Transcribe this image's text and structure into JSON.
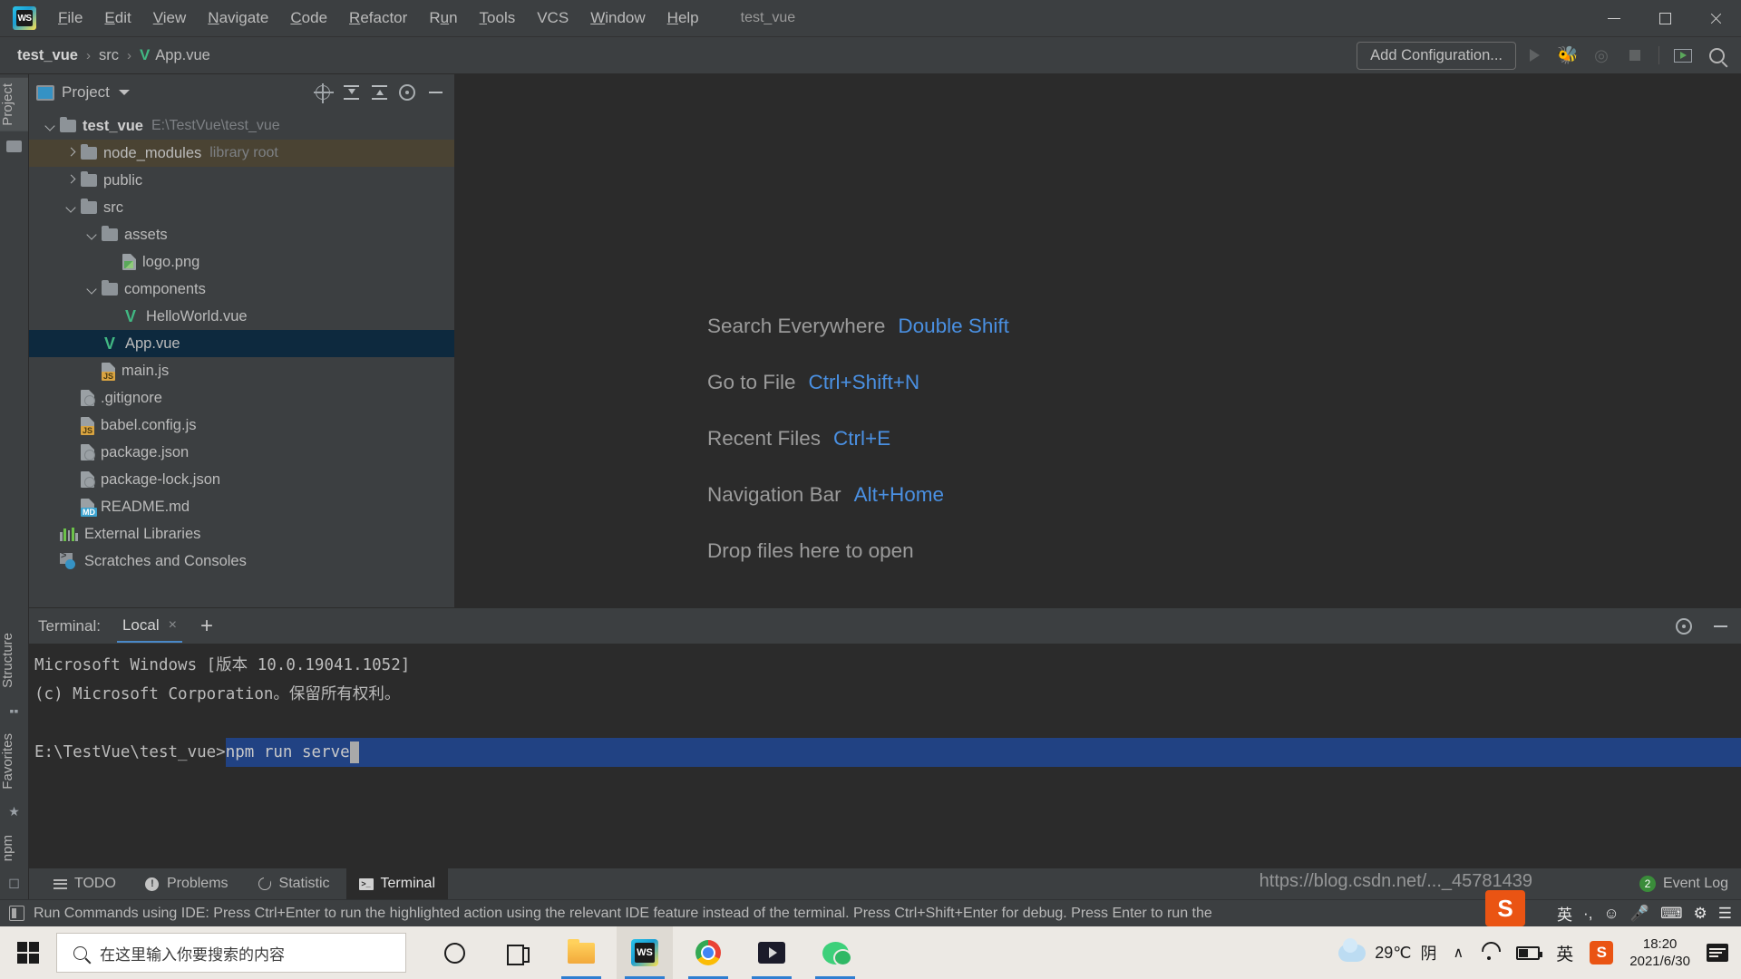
{
  "window": {
    "title": "test_vue",
    "app_logo": "WS",
    "controls": {
      "minimize": "minimize-icon",
      "maximize": "maximize-icon",
      "close": "close-icon"
    }
  },
  "menu": {
    "items": [
      {
        "label": "File",
        "mnemonic": "F"
      },
      {
        "label": "Edit",
        "mnemonic": "E"
      },
      {
        "label": "View",
        "mnemonic": "V"
      },
      {
        "label": "Navigate",
        "mnemonic": "N"
      },
      {
        "label": "Code",
        "mnemonic": "C"
      },
      {
        "label": "Refactor",
        "mnemonic": "R"
      },
      {
        "label": "Run",
        "mnemonic": "u"
      },
      {
        "label": "Tools",
        "mnemonic": "T"
      },
      {
        "label": "VCS",
        "mnemonic": ""
      },
      {
        "label": "Window",
        "mnemonic": "W"
      },
      {
        "label": "Help",
        "mnemonic": "H"
      }
    ]
  },
  "navbar": {
    "breadcrumbs": [
      {
        "label": "test_vue",
        "icon": ""
      },
      {
        "label": "src",
        "icon": ""
      },
      {
        "label": "App.vue",
        "icon": "vue-icon"
      }
    ],
    "separator": "›",
    "add_configuration": "Add Configuration...",
    "icons": [
      "run-icon",
      "debug-icon",
      "run-coverage-icon",
      "stop-icon",
      "show-console-icon",
      "search-icon"
    ]
  },
  "left_stripe": {
    "top_tabs": [
      {
        "label": "Project",
        "active": true
      }
    ],
    "bottom_tabs": [
      {
        "label": "Structure"
      },
      {
        "label": "Favorites"
      },
      {
        "label": "npm"
      }
    ]
  },
  "project_panel": {
    "title": "Project",
    "actions": [
      "locate-icon",
      "expand-all-icon",
      "collapse-all-icon",
      "gear-icon",
      "hide-icon"
    ],
    "tree": [
      {
        "indent": 0,
        "arrow": "down",
        "icon": "folder-icon",
        "label": "test_vue",
        "suffix": "E:\\TestVue\\test_vue",
        "bold": true,
        "state": "normal"
      },
      {
        "indent": 1,
        "arrow": "right",
        "icon": "folder-icon",
        "label": "node_modules",
        "suffix": "library root",
        "bold": false,
        "state": "hover"
      },
      {
        "indent": 1,
        "arrow": "right",
        "icon": "folder-icon",
        "label": "public",
        "suffix": "",
        "bold": false,
        "state": "normal"
      },
      {
        "indent": 1,
        "arrow": "down",
        "icon": "folder-icon",
        "label": "src",
        "suffix": "",
        "bold": false,
        "state": "normal"
      },
      {
        "indent": 2,
        "arrow": "down",
        "icon": "folder-icon",
        "label": "assets",
        "suffix": "",
        "bold": false,
        "state": "normal"
      },
      {
        "indent": 3,
        "arrow": "none",
        "icon": "image-file-icon",
        "label": "logo.png",
        "suffix": "",
        "bold": false,
        "state": "normal"
      },
      {
        "indent": 2,
        "arrow": "down",
        "icon": "folder-icon",
        "label": "components",
        "suffix": "",
        "bold": false,
        "state": "normal"
      },
      {
        "indent": 3,
        "arrow": "none",
        "icon": "vue-icon",
        "label": "HelloWorld.vue",
        "suffix": "",
        "bold": false,
        "state": "normal"
      },
      {
        "indent": 2,
        "arrow": "none",
        "icon": "vue-icon",
        "label": "App.vue",
        "suffix": "",
        "bold": false,
        "state": "selected"
      },
      {
        "indent": 2,
        "arrow": "none",
        "icon": "js-file-icon",
        "label": "main.js",
        "suffix": "",
        "bold": false,
        "state": "normal"
      },
      {
        "indent": 1,
        "arrow": "none",
        "icon": "gitignore-file-icon",
        "label": ".gitignore",
        "suffix": "",
        "bold": false,
        "state": "normal"
      },
      {
        "indent": 1,
        "arrow": "none",
        "icon": "js-file-icon",
        "label": "babel.config.js",
        "suffix": "",
        "bold": false,
        "state": "normal"
      },
      {
        "indent": 1,
        "arrow": "none",
        "icon": "json-file-icon",
        "label": "package.json",
        "suffix": "",
        "bold": false,
        "state": "normal"
      },
      {
        "indent": 1,
        "arrow": "none",
        "icon": "json-file-icon",
        "label": "package-lock.json",
        "suffix": "",
        "bold": false,
        "state": "normal"
      },
      {
        "indent": 1,
        "arrow": "none",
        "icon": "md-file-icon",
        "label": "README.md",
        "suffix": "",
        "bold": false,
        "state": "normal"
      },
      {
        "indent": 0,
        "arrow": "none",
        "icon": "libraries-icon",
        "label": "External Libraries",
        "suffix": "",
        "bold": false,
        "state": "normal"
      },
      {
        "indent": 0,
        "arrow": "none",
        "icon": "scratches-icon",
        "label": "Scratches and Consoles",
        "suffix": "",
        "bold": false,
        "state": "normal"
      }
    ]
  },
  "editor": {
    "hints": [
      {
        "name": "Search Everywhere",
        "key": "Double Shift"
      },
      {
        "name": "Go to File",
        "key": "Ctrl+Shift+N"
      },
      {
        "name": "Recent Files",
        "key": "Ctrl+E"
      },
      {
        "name": "Navigation Bar",
        "key": "Alt+Home"
      },
      {
        "name": "Drop files here to open",
        "key": ""
      }
    ]
  },
  "terminal": {
    "label": "Terminal:",
    "tab": {
      "label": "Local",
      "close": "×"
    },
    "add_tab": "+",
    "header_icons": [
      "gear-icon",
      "hide-icon"
    ],
    "lines": [
      "Microsoft Windows [版本 10.0.19041.1052]",
      "(c) Microsoft Corporation。保留所有权利。",
      ""
    ],
    "prompt": "E:\\TestVue\\test_vue>",
    "command": "npm run serve"
  },
  "bottom_tabs": {
    "tabs": [
      {
        "label": "TODO",
        "icon": "todo-icon",
        "active": false
      },
      {
        "label": "Problems",
        "icon": "problems-icon",
        "active": false
      },
      {
        "label": "Statistic",
        "icon": "statistic-icon",
        "active": false
      },
      {
        "label": "Terminal",
        "icon": "terminal-icon",
        "active": true
      }
    ],
    "event_log": {
      "label": "Event Log",
      "count": "2"
    }
  },
  "statusbar": {
    "icon": "tip-icon",
    "message": "Run Commands using IDE: Press Ctrl+Enter to run the highlighted action using the relevant IDE feature instead of the terminal. Press Ctrl+Shift+Enter for debug. Press Enter to run the"
  },
  "taskbar": {
    "start": "windows-start-icon",
    "search_placeholder": "在这里输入你要搜索的内容",
    "apps": [
      {
        "name": "cortana-icon"
      },
      {
        "name": "task-view-icon"
      },
      {
        "name": "file-explorer-icon"
      },
      {
        "name": "webstorm-icon"
      },
      {
        "name": "chrome-icon"
      },
      {
        "name": "video-player-icon"
      },
      {
        "name": "wechat-icon"
      }
    ],
    "tray": {
      "weather_temp": "29℃",
      "weather_desc": "阴",
      "chevron": "∧",
      "ime": "英",
      "sogou": "S",
      "time": "18:20",
      "date": "2021/6/30",
      "notifications": "notification-icon"
    }
  },
  "watermark": "https://blog.csdn.net/..._45781439"
}
